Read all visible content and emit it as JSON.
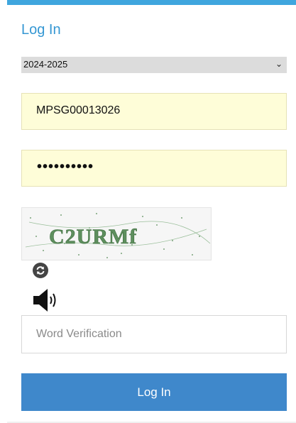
{
  "login": {
    "title": "Log In",
    "year_selected": "2024-2025",
    "username_value": "MPSG00013026",
    "password_masked": "••••••••••",
    "captcha_text": "C2URMf",
    "word_placeholder": "Word Verification",
    "submit_label": "Log In"
  },
  "colors": {
    "accent": "#3fa6de",
    "title": "#3597d3",
    "button": "#3f88cb",
    "field_bg": "#fefdd8"
  },
  "icons": {
    "refresh": "refresh-icon",
    "audio": "speaker-icon",
    "dropdown": "chevron-down-icon"
  }
}
